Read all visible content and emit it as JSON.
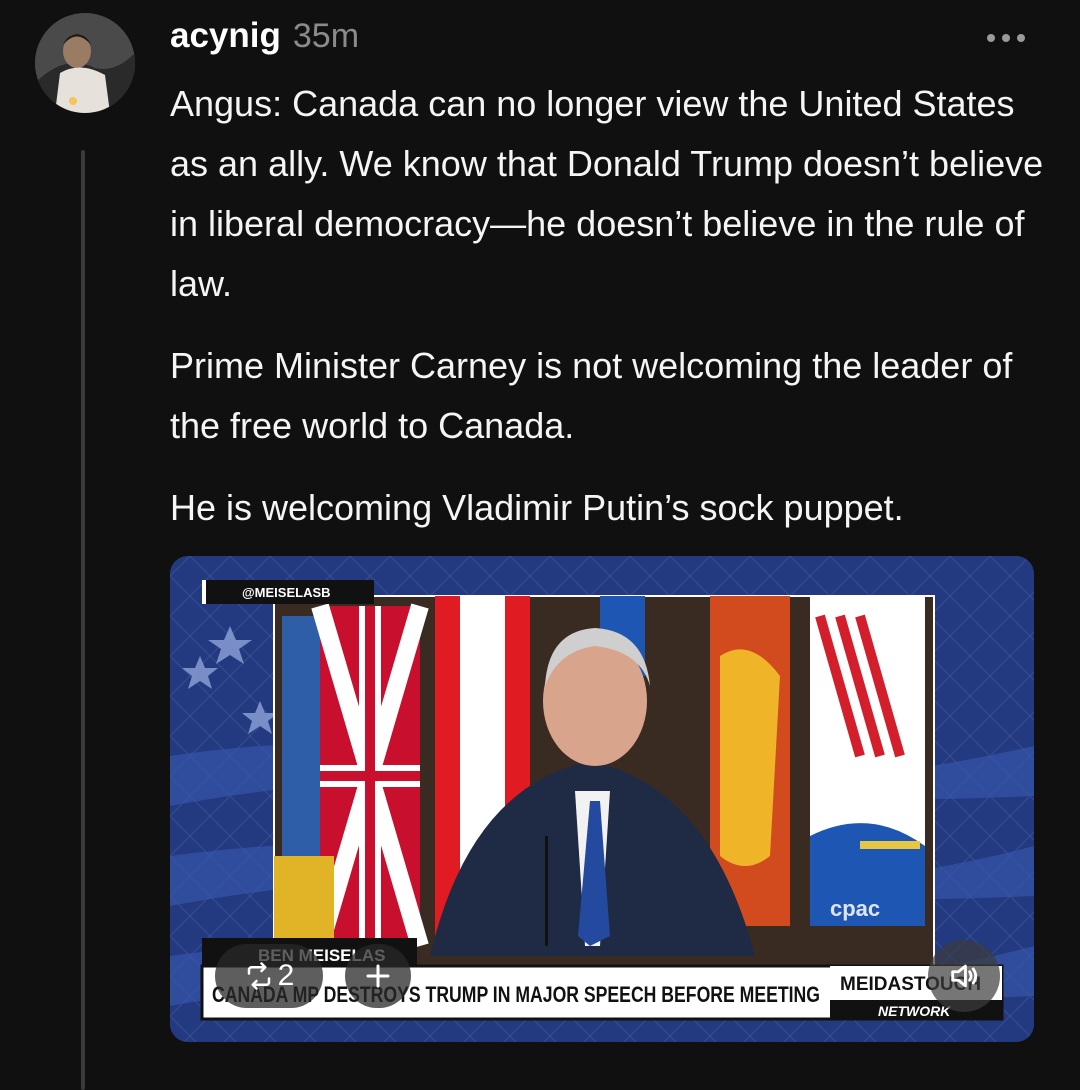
{
  "post": {
    "username": "acynig",
    "timestamp": "35m",
    "paragraphs": [
      "Angus: Canada can no longer view the United States as an ally. We know that Donald Trump doesn’t believe in liberal democracy—he doesn’t believe in the rule of law.",
      "Prime Minister Carney is not welcoming the leader of the free world to Canada.",
      "He is welcoming Vladimir Putin’s sock puppet."
    ]
  },
  "video": {
    "handle_tag": "@MEISELASB",
    "speaker_name": "BEN MEISELAS",
    "headline": "CANADA MP DESTROYS TRUMP IN MAJOR SPEECH BEFORE MEETING",
    "brand_top": "MEIDASTOUCH",
    "brand_bottom": "NETWORK",
    "watermark": "cpac"
  },
  "controls": {
    "repost_count": "2",
    "icons": [
      "repost-icon",
      "add-icon",
      "sound-icon",
      "more-icon"
    ]
  },
  "colors": {
    "background": "#101010",
    "text": "#f5f5f5",
    "muted": "#8b8b8b",
    "video_bg": "#2a3a74"
  }
}
